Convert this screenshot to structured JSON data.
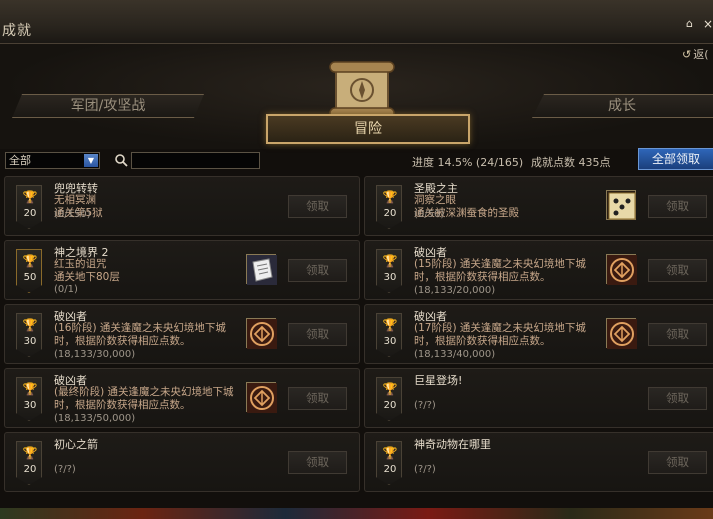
{
  "window": {
    "title": "成就",
    "home_icon": "home-icon",
    "close_label": "×",
    "back_label": "返("
  },
  "tabs": {
    "left": "军团/攻坚战",
    "center": "冒险",
    "right": "成长"
  },
  "toolbar": {
    "filter_value": "全部",
    "search_value": "",
    "progress_label": "进度 14.5% (24/165)",
    "points_label": "成就点数 435点",
    "claim_all_label": "全部领取"
  },
  "cards": [
    {
      "title": "兜兜转转",
      "desc": "无相冥渊\n通关第5狱",
      "progress": "(0/150)",
      "points": "20",
      "cup": "silver",
      "reward": null,
      "claim": "领取"
    },
    {
      "title": "圣殿之主",
      "desc": "洞察之眼\n通关被深渊蚕食的圣殿",
      "progress": "(0/50)",
      "points": "20",
      "cup": "silver",
      "reward": "dice-icon",
      "claim": "领取"
    },
    {
      "title": "神之境界 2",
      "desc": "红玉的诅咒\n通关地下80层",
      "progress": "(0/1)",
      "points": "50",
      "cup": "gold",
      "reward": "scroll-paper-icon",
      "claim": "领取"
    },
    {
      "title": "破凶者",
      "desc": "(15阶段) 通关逢魔之未央幻境地下城时，根据阶数获得相应点数。",
      "progress": "(18,133/20,000)",
      "points": "30",
      "cup": "silver",
      "reward": "emblem-icon",
      "claim": "领取"
    },
    {
      "title": "破凶者",
      "desc": "(16阶段) 通关逢魔之未央幻境地下城时，根据阶数获得相应点数。",
      "progress": "(18,133/30,000)",
      "points": "30",
      "cup": "silver",
      "reward": "emblem-icon",
      "claim": "领取"
    },
    {
      "title": "破凶者",
      "desc": "(17阶段) 通关逢魔之未央幻境地下城时，根据阶数获得相应点数。",
      "progress": "(18,133/40,000)",
      "points": "30",
      "cup": "silver",
      "reward": "emblem-icon",
      "claim": "领取"
    },
    {
      "title": "破凶者",
      "desc": "(最终阶段) 通关逢魔之未央幻境地下城时，根据阶数获得相应点数。",
      "progress": "(18,133/50,000)",
      "points": "30",
      "cup": "silver",
      "reward": "emblem-icon",
      "claim": "领取"
    },
    {
      "title": "巨星登场!",
      "desc": "",
      "progress": "(?/?)",
      "points": "20",
      "cup": "silver",
      "reward": null,
      "claim": "领取"
    },
    {
      "title": "初心之箭",
      "desc": "",
      "progress": "(?/?)",
      "points": "20",
      "cup": "silver",
      "reward": null,
      "claim": "领取"
    },
    {
      "title": "神奇动物在哪里",
      "desc": "",
      "progress": "(?/?)",
      "points": "20",
      "cup": "silver",
      "reward": null,
      "claim": "领取"
    }
  ]
}
